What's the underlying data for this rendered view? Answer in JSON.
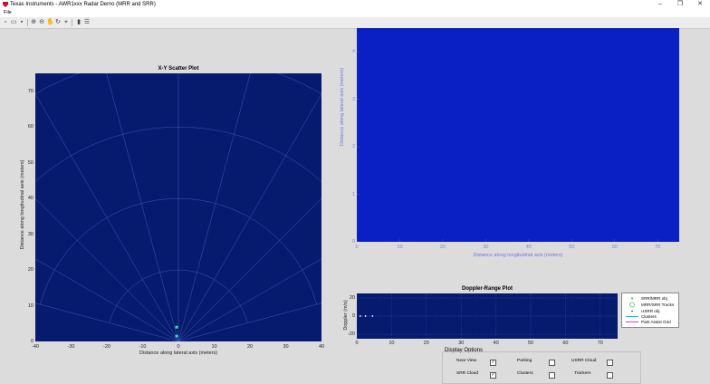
{
  "window": {
    "title": "Texas Instruments - AWR1xxx Radar Demo (MRR and SRR)",
    "minimize": "–",
    "maximize": "❐",
    "close": "✕"
  },
  "menu": {
    "file": "File"
  },
  "toolbar": {
    "icons": [
      "new-file-icon",
      "open-folder-icon",
      "save-icon",
      "print-icon",
      "zoom-in-icon",
      "zoom-out-icon",
      "pan-icon",
      "rotate-icon",
      "data-cursor-icon",
      "brush-icon",
      "insert-colorbar-icon",
      "insert-legend-icon"
    ]
  },
  "colors": {
    "plot_bg": "#071b6e",
    "plot_bg2": "#0a1fc4",
    "grid": "#3e55b5",
    "points": "#2ee6a0",
    "range_axis": "#1a2aa8"
  },
  "xy_plot": {
    "title": "X-Y Scatter Plot",
    "xlabel": "Distance along lateral axis (meters)",
    "ylabel": "Distance along longitudinal axis (meters)",
    "xticks": [
      "-40",
      "-30",
      "-20",
      "-10",
      "0",
      "10",
      "20",
      "30",
      "40"
    ],
    "yticks": [
      "70",
      "60",
      "50",
      "40",
      "30",
      "20",
      "10",
      "0"
    ]
  },
  "range_plot": {
    "xlabel": "Distance along longitudinal axis (meters)",
    "ylabel": "Distance along lateral axis (meters)",
    "xticks": [
      "0",
      "10",
      "20",
      "30",
      "40",
      "50",
      "60",
      "70"
    ],
    "yticks": [
      "4",
      "3",
      "2",
      "1",
      "0"
    ]
  },
  "doppler_plot": {
    "title": "Doppler-Range Plot",
    "ylabel": "Doppler (m/s)",
    "xticks": [
      "0",
      "10",
      "20",
      "30",
      "40",
      "50",
      "60",
      "70"
    ],
    "yticks": [
      "20",
      "0",
      "-20"
    ]
  },
  "legend": {
    "items": [
      {
        "label": "SRR/MRR obj"
      },
      {
        "label": "MRR/SRR Tracks"
      },
      {
        "label": "USRR obj"
      },
      {
        "label": "Clusters"
      },
      {
        "label": "Park Assist Grid"
      }
    ]
  },
  "display_options": {
    "title": "Display Options",
    "near_view": "Near View",
    "near_view_checked": "✓",
    "parking": "Parking",
    "usrr_cloud": "USRR Cloud",
    "srr_cloud": "SRR Cloud",
    "srr_cloud_checked": "✓",
    "clusters": "Clusters",
    "trackers": "Trackers"
  },
  "chart_data": [
    {
      "type": "scatter",
      "title": "X-Y Scatter Plot",
      "xlabel": "Distance along lateral axis (meters)",
      "ylabel": "Distance along longitudinal axis (meters)",
      "xlim": [
        -40,
        40
      ],
      "ylim": [
        0,
        75
      ],
      "series": [
        {
          "x": [
            -0.5,
            -0.5
          ],
          "y": [
            4,
            1.5
          ]
        }
      ]
    },
    {
      "type": "scatter",
      "title": "Doppler-Range Plot",
      "ylabel": "Doppler (m/s)",
      "xlim": [
        0,
        75
      ],
      "ylim": [
        -25,
        25
      ],
      "series": [
        {
          "x": [
            1,
            2.5,
            4.5
          ],
          "y": [
            0,
            0,
            0
          ]
        }
      ]
    }
  ]
}
